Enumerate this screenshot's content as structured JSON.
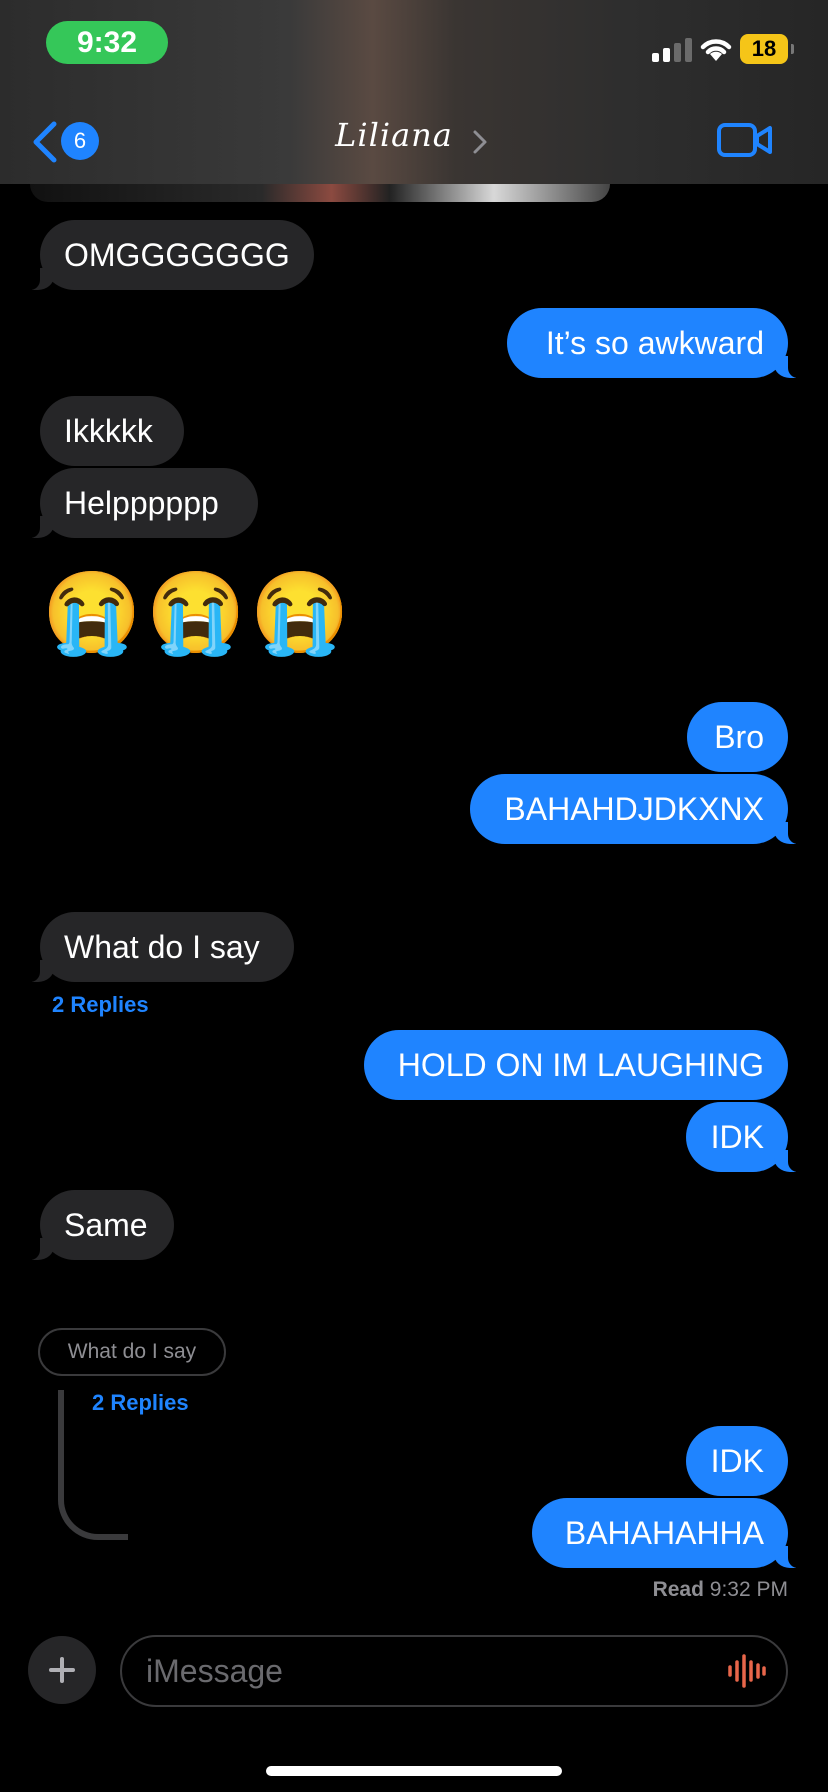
{
  "status_bar": {
    "time": "9:32",
    "battery": "18"
  },
  "header": {
    "back_count": "6",
    "contact_name": "Liliana"
  },
  "messages": [
    {
      "dir": "recv",
      "text": "OMGGGGGGG"
    },
    {
      "dir": "sent",
      "text": "It’s so awkward"
    },
    {
      "dir": "recv",
      "text": "Ikkkkk"
    },
    {
      "dir": "recv",
      "text": "Helpppppp"
    },
    {
      "dir": "recv",
      "text": "😭😭😭"
    },
    {
      "dir": "sent",
      "text": "Bro"
    },
    {
      "dir": "sent",
      "text": "BAHAHDJDKXNX"
    },
    {
      "dir": "recv",
      "text": "What do I say"
    },
    {
      "dir": "sent",
      "text": "HOLD ON IM LAUGHING"
    },
    {
      "dir": "sent",
      "text": "IDK"
    },
    {
      "dir": "recv",
      "text": "Same"
    },
    {
      "dir": "sent",
      "text": "IDK"
    },
    {
      "dir": "sent",
      "text": "BAHAHAHHA"
    }
  ],
  "emoji": "😭",
  "replies_label": "2 Replies",
  "thread": {
    "quoted_text": "What do I say",
    "replies_label": "2 Replies"
  },
  "read_receipt": {
    "label": "Read",
    "time": "9:32 PM"
  },
  "input": {
    "placeholder": "iMessage"
  },
  "colors": {
    "sent_bubble": "#1f84ff",
    "received_bubble": "#262628",
    "time_pill": "#35c759",
    "battery": "#f5c518"
  }
}
